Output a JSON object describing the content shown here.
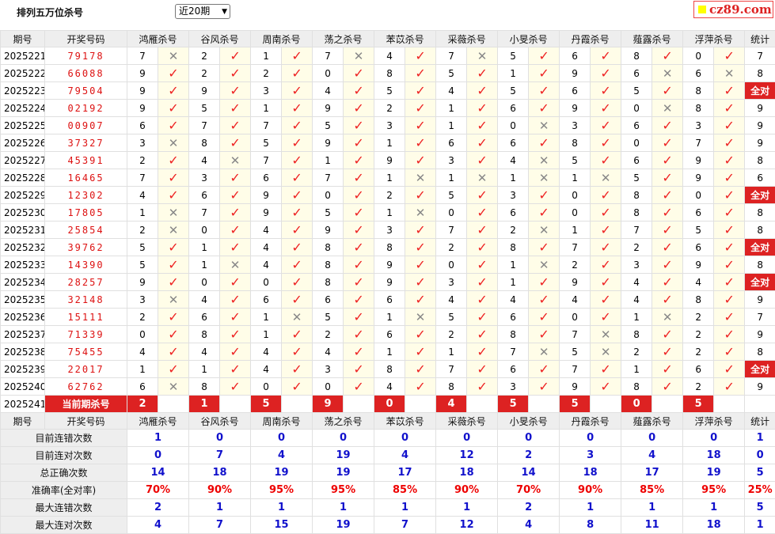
{
  "title": "排列五万位杀号",
  "period_select": "近20期",
  "logo": "cz89.com",
  "headers": [
    "期号",
    "开奖号码",
    "鸿雁杀号",
    "谷风杀号",
    "周南杀号",
    "荡之杀号",
    "苯苡杀号",
    "采薇杀号",
    "小旻杀号",
    "丹霞杀号",
    "薤露杀号",
    "浮萍杀号",
    "统计"
  ],
  "all_correct_label": "全对",
  "current_label": "当前期杀号",
  "current_issue": "2025241",
  "current_kills": [
    "2",
    "1",
    "5",
    "9",
    "0",
    "4",
    "5",
    "5",
    "0",
    "5"
  ],
  "rows": [
    {
      "issue": "2025221",
      "draw": "79178",
      "kills": [
        [
          7,
          0
        ],
        [
          2,
          1
        ],
        [
          1,
          1
        ],
        [
          7,
          0
        ],
        [
          4,
          1
        ],
        [
          7,
          0
        ],
        [
          5,
          1
        ],
        [
          6,
          1
        ],
        [
          8,
          1
        ],
        [
          0,
          1
        ]
      ],
      "count": "7"
    },
    {
      "issue": "2025222",
      "draw": "66088",
      "kills": [
        [
          9,
          1
        ],
        [
          2,
          1
        ],
        [
          2,
          1
        ],
        [
          0,
          1
        ],
        [
          8,
          1
        ],
        [
          5,
          1
        ],
        [
          1,
          1
        ],
        [
          9,
          1
        ],
        [
          6,
          0
        ],
        [
          6,
          0
        ]
      ],
      "count": "8"
    },
    {
      "issue": "2025223",
      "draw": "79504",
      "kills": [
        [
          9,
          1
        ],
        [
          9,
          1
        ],
        [
          3,
          1
        ],
        [
          4,
          1
        ],
        [
          5,
          1
        ],
        [
          4,
          1
        ],
        [
          5,
          1
        ],
        [
          6,
          1
        ],
        [
          5,
          1
        ],
        [
          8,
          1
        ]
      ],
      "count": "全对"
    },
    {
      "issue": "2025224",
      "draw": "02192",
      "kills": [
        [
          9,
          1
        ],
        [
          5,
          1
        ],
        [
          1,
          1
        ],
        [
          9,
          1
        ],
        [
          2,
          1
        ],
        [
          1,
          1
        ],
        [
          6,
          1
        ],
        [
          9,
          1
        ],
        [
          0,
          0
        ],
        [
          8,
          1
        ]
      ],
      "count": "9"
    },
    {
      "issue": "2025225",
      "draw": "00907",
      "kills": [
        [
          6,
          1
        ],
        [
          7,
          1
        ],
        [
          7,
          1
        ],
        [
          5,
          1
        ],
        [
          3,
          1
        ],
        [
          1,
          1
        ],
        [
          0,
          0
        ],
        [
          3,
          1
        ],
        [
          6,
          1
        ],
        [
          3,
          1
        ]
      ],
      "count": "9"
    },
    {
      "issue": "2025226",
      "draw": "37327",
      "kills": [
        [
          3,
          0
        ],
        [
          8,
          1
        ],
        [
          5,
          1
        ],
        [
          9,
          1
        ],
        [
          1,
          1
        ],
        [
          6,
          1
        ],
        [
          6,
          1
        ],
        [
          8,
          1
        ],
        [
          0,
          1
        ],
        [
          7,
          1
        ]
      ],
      "count": "9"
    },
    {
      "issue": "2025227",
      "draw": "45391",
      "kills": [
        [
          2,
          1
        ],
        [
          4,
          0
        ],
        [
          7,
          1
        ],
        [
          1,
          1
        ],
        [
          9,
          1
        ],
        [
          3,
          1
        ],
        [
          4,
          0
        ],
        [
          5,
          1
        ],
        [
          6,
          1
        ],
        [
          9,
          1
        ]
      ],
      "count": "8"
    },
    {
      "issue": "2025228",
      "draw": "16465",
      "kills": [
        [
          7,
          1
        ],
        [
          3,
          1
        ],
        [
          6,
          1
        ],
        [
          7,
          1
        ],
        [
          1,
          0
        ],
        [
          1,
          0
        ],
        [
          1,
          0
        ],
        [
          1,
          0
        ],
        [
          5,
          1
        ],
        [
          9,
          1
        ]
      ],
      "count": "6"
    },
    {
      "issue": "2025229",
      "draw": "12302",
      "kills": [
        [
          4,
          1
        ],
        [
          6,
          1
        ],
        [
          9,
          1
        ],
        [
          0,
          1
        ],
        [
          2,
          1
        ],
        [
          5,
          1
        ],
        [
          3,
          1
        ],
        [
          0,
          1
        ],
        [
          8,
          1
        ],
        [
          0,
          1
        ]
      ],
      "count": "全对"
    },
    {
      "issue": "2025230",
      "draw": "17805",
      "kills": [
        [
          1,
          0
        ],
        [
          7,
          1
        ],
        [
          9,
          1
        ],
        [
          5,
          1
        ],
        [
          1,
          0
        ],
        [
          0,
          1
        ],
        [
          6,
          1
        ],
        [
          0,
          1
        ],
        [
          8,
          1
        ],
        [
          6,
          1
        ]
      ],
      "count": "8"
    },
    {
      "issue": "2025231",
      "draw": "25854",
      "kills": [
        [
          2,
          0
        ],
        [
          0,
          1
        ],
        [
          4,
          1
        ],
        [
          9,
          1
        ],
        [
          3,
          1
        ],
        [
          7,
          1
        ],
        [
          2,
          0
        ],
        [
          1,
          1
        ],
        [
          7,
          1
        ],
        [
          5,
          1
        ]
      ],
      "count": "8"
    },
    {
      "issue": "2025232",
      "draw": "39762",
      "kills": [
        [
          5,
          1
        ],
        [
          1,
          1
        ],
        [
          4,
          1
        ],
        [
          8,
          1
        ],
        [
          8,
          1
        ],
        [
          2,
          1
        ],
        [
          8,
          1
        ],
        [
          7,
          1
        ],
        [
          2,
          1
        ],
        [
          6,
          1
        ]
      ],
      "count": "全对"
    },
    {
      "issue": "2025233",
      "draw": "14390",
      "kills": [
        [
          5,
          1
        ],
        [
          1,
          0
        ],
        [
          4,
          1
        ],
        [
          8,
          1
        ],
        [
          9,
          1
        ],
        [
          0,
          1
        ],
        [
          1,
          0
        ],
        [
          2,
          1
        ],
        [
          3,
          1
        ],
        [
          9,
          1
        ]
      ],
      "count": "8"
    },
    {
      "issue": "2025234",
      "draw": "28257",
      "kills": [
        [
          9,
          1
        ],
        [
          0,
          1
        ],
        [
          0,
          1
        ],
        [
          8,
          1
        ],
        [
          9,
          1
        ],
        [
          3,
          1
        ],
        [
          1,
          1
        ],
        [
          9,
          1
        ],
        [
          4,
          1
        ],
        [
          4,
          1
        ]
      ],
      "count": "全对"
    },
    {
      "issue": "2025235",
      "draw": "32148",
      "kills": [
        [
          3,
          0
        ],
        [
          4,
          1
        ],
        [
          6,
          1
        ],
        [
          6,
          1
        ],
        [
          6,
          1
        ],
        [
          4,
          1
        ],
        [
          4,
          1
        ],
        [
          4,
          1
        ],
        [
          4,
          1
        ],
        [
          8,
          1
        ]
      ],
      "count": "9"
    },
    {
      "issue": "2025236",
      "draw": "15111",
      "kills": [
        [
          2,
          1
        ],
        [
          6,
          1
        ],
        [
          1,
          0
        ],
        [
          5,
          1
        ],
        [
          1,
          0
        ],
        [
          5,
          1
        ],
        [
          6,
          1
        ],
        [
          0,
          1
        ],
        [
          1,
          0
        ],
        [
          2,
          1
        ]
      ],
      "count": "7"
    },
    {
      "issue": "2025237",
      "draw": "71339",
      "kills": [
        [
          0,
          1
        ],
        [
          8,
          1
        ],
        [
          1,
          1
        ],
        [
          2,
          1
        ],
        [
          6,
          1
        ],
        [
          2,
          1
        ],
        [
          8,
          1
        ],
        [
          7,
          0
        ],
        [
          8,
          1
        ],
        [
          2,
          1
        ]
      ],
      "count": "9"
    },
    {
      "issue": "2025238",
      "draw": "75455",
      "kills": [
        [
          4,
          1
        ],
        [
          4,
          1
        ],
        [
          4,
          1
        ],
        [
          4,
          1
        ],
        [
          1,
          1
        ],
        [
          1,
          1
        ],
        [
          7,
          0
        ],
        [
          5,
          0
        ],
        [
          2,
          1
        ],
        [
          2,
          1
        ]
      ],
      "count": "8"
    },
    {
      "issue": "2025239",
      "draw": "22017",
      "kills": [
        [
          1,
          1
        ],
        [
          1,
          1
        ],
        [
          4,
          1
        ],
        [
          3,
          1
        ],
        [
          8,
          1
        ],
        [
          7,
          1
        ],
        [
          6,
          1
        ],
        [
          7,
          1
        ],
        [
          1,
          1
        ],
        [
          6,
          1
        ]
      ],
      "count": "全对"
    },
    {
      "issue": "2025240",
      "draw": "62762",
      "kills": [
        [
          6,
          0
        ],
        [
          8,
          1
        ],
        [
          0,
          1
        ],
        [
          0,
          1
        ],
        [
          4,
          1
        ],
        [
          8,
          1
        ],
        [
          3,
          1
        ],
        [
          9,
          1
        ],
        [
          8,
          1
        ],
        [
          2,
          1
        ]
      ],
      "count": "9"
    }
  ],
  "stats": [
    {
      "label": "目前连错次数",
      "values": [
        "1",
        "0",
        "0",
        "0",
        "0",
        "0",
        "0",
        "0",
        "0",
        "0"
      ],
      "total": "1"
    },
    {
      "label": "目前连对次数",
      "values": [
        "0",
        "7",
        "4",
        "19",
        "4",
        "12",
        "2",
        "3",
        "4",
        "18"
      ],
      "total": "0"
    },
    {
      "label": "总正确次数",
      "values": [
        "14",
        "18",
        "19",
        "19",
        "17",
        "18",
        "14",
        "18",
        "17",
        "19"
      ],
      "total": "5"
    },
    {
      "label": "准确率(全对率)",
      "values": [
        "70%",
        "90%",
        "95%",
        "95%",
        "85%",
        "90%",
        "70%",
        "90%",
        "85%",
        "95%"
      ],
      "total": "25%"
    },
    {
      "label": "最大连错次数",
      "values": [
        "2",
        "1",
        "1",
        "1",
        "1",
        "1",
        "2",
        "1",
        "1",
        "1"
      ],
      "total": "5"
    },
    {
      "label": "最大连对次数",
      "values": [
        "4",
        "7",
        "15",
        "19",
        "7",
        "12",
        "4",
        "8",
        "11",
        "18"
      ],
      "total": "1"
    }
  ]
}
